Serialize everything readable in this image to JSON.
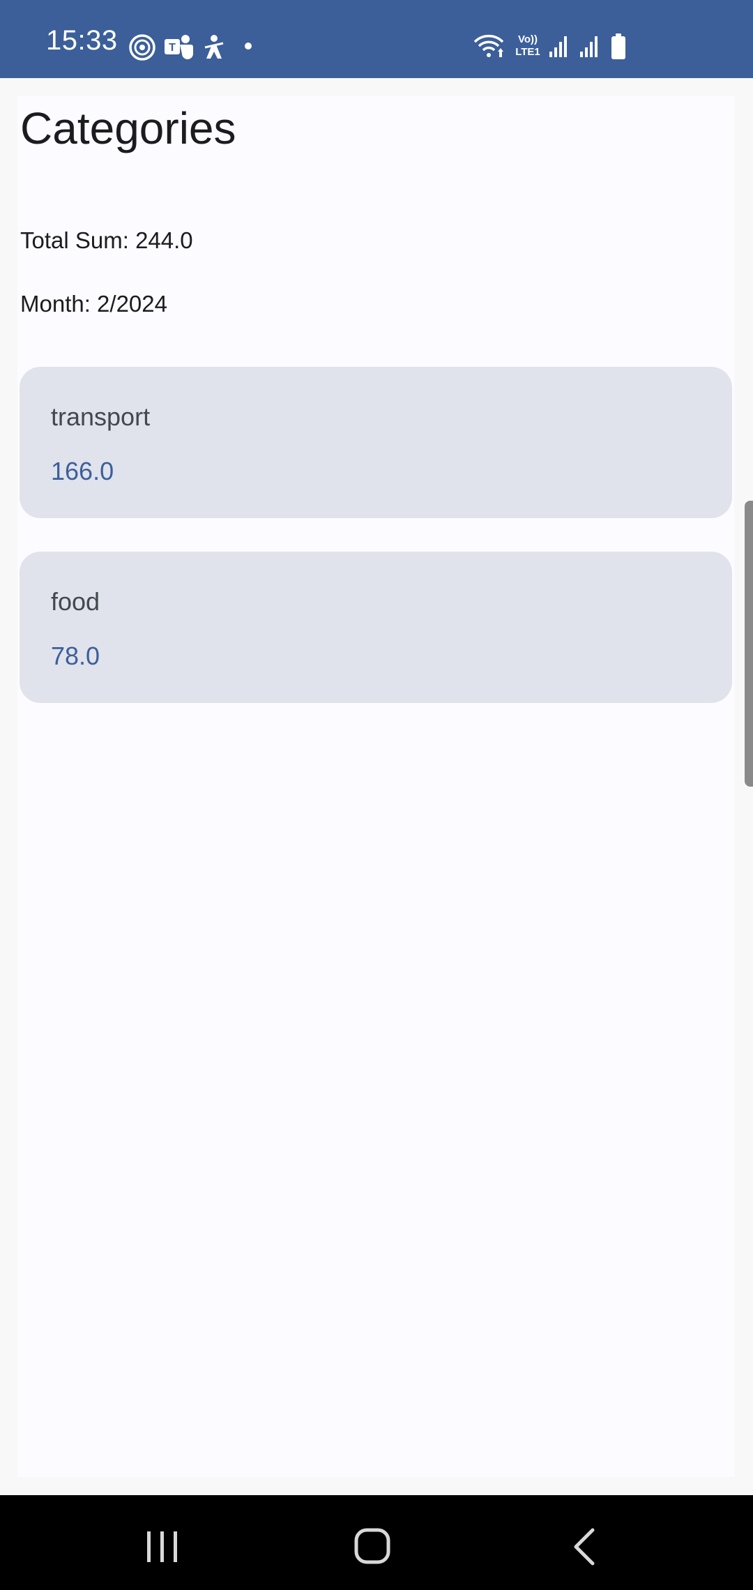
{
  "status_bar": {
    "time": "15:33",
    "left_icons": [
      "at-sign-icon",
      "teams-icon",
      "accessibility-icon",
      "dot-icon"
    ],
    "right_icons": [
      "wifi-icon",
      "volte-icon",
      "signal-icon",
      "signal-icon",
      "battery-icon"
    ],
    "volte_label_top": "Vo))",
    "volte_label_bottom": "LTE1",
    "background_color": "#3c5f9a"
  },
  "page": {
    "title": "Categories",
    "total_sum": "Total Sum: 244.0",
    "month": "Month: 2/2024"
  },
  "categories": [
    {
      "name": "transport",
      "amount": "166.0"
    },
    {
      "name": "food",
      "amount": "78.0"
    }
  ],
  "colors": {
    "accent": "#3c5f9a",
    "card_background": "#e0e2ec",
    "page_background": "#fcfbff"
  },
  "nav_bar": {
    "buttons": [
      "recents-icon",
      "home-icon",
      "back-icon"
    ]
  }
}
